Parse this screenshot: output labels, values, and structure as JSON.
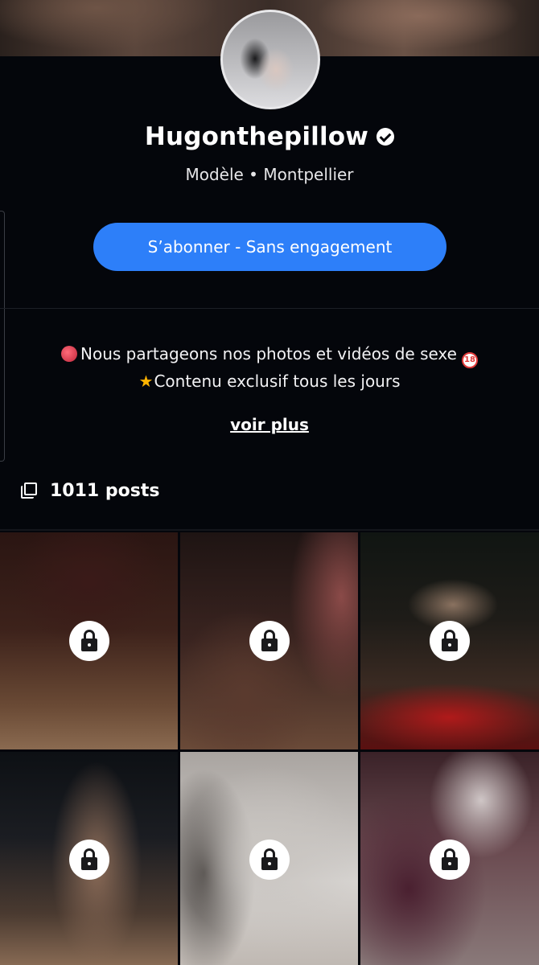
{
  "profile": {
    "name": "Hugonthepillow",
    "verified": true,
    "subtitle": "Modèle • Montpellier"
  },
  "actions": {
    "subscribe_label": "S’abonner - Sans engagement",
    "subscribe_color": "#2d7ff9"
  },
  "bio": {
    "line1": "Nous partageons nos photos et vidéos de sexe",
    "line1_badge": "18",
    "line2": "Contenu exclusif tous les jours",
    "more_label": "voir plus"
  },
  "posts": {
    "count_label": "1011 posts"
  },
  "grid": {
    "tiles": [
      {
        "locked": true
      },
      {
        "locked": true
      },
      {
        "locked": true
      },
      {
        "locked": true
      },
      {
        "locked": true
      },
      {
        "locked": true
      }
    ]
  },
  "icons": {
    "verified": "verified-badge-icon",
    "posts": "multiple-posts-icon",
    "lock": "lock-icon",
    "emoji_devil": "devil-face-emoji",
    "emoji_18": "no-under-18-emoji",
    "emoji_star": "star-emoji"
  }
}
